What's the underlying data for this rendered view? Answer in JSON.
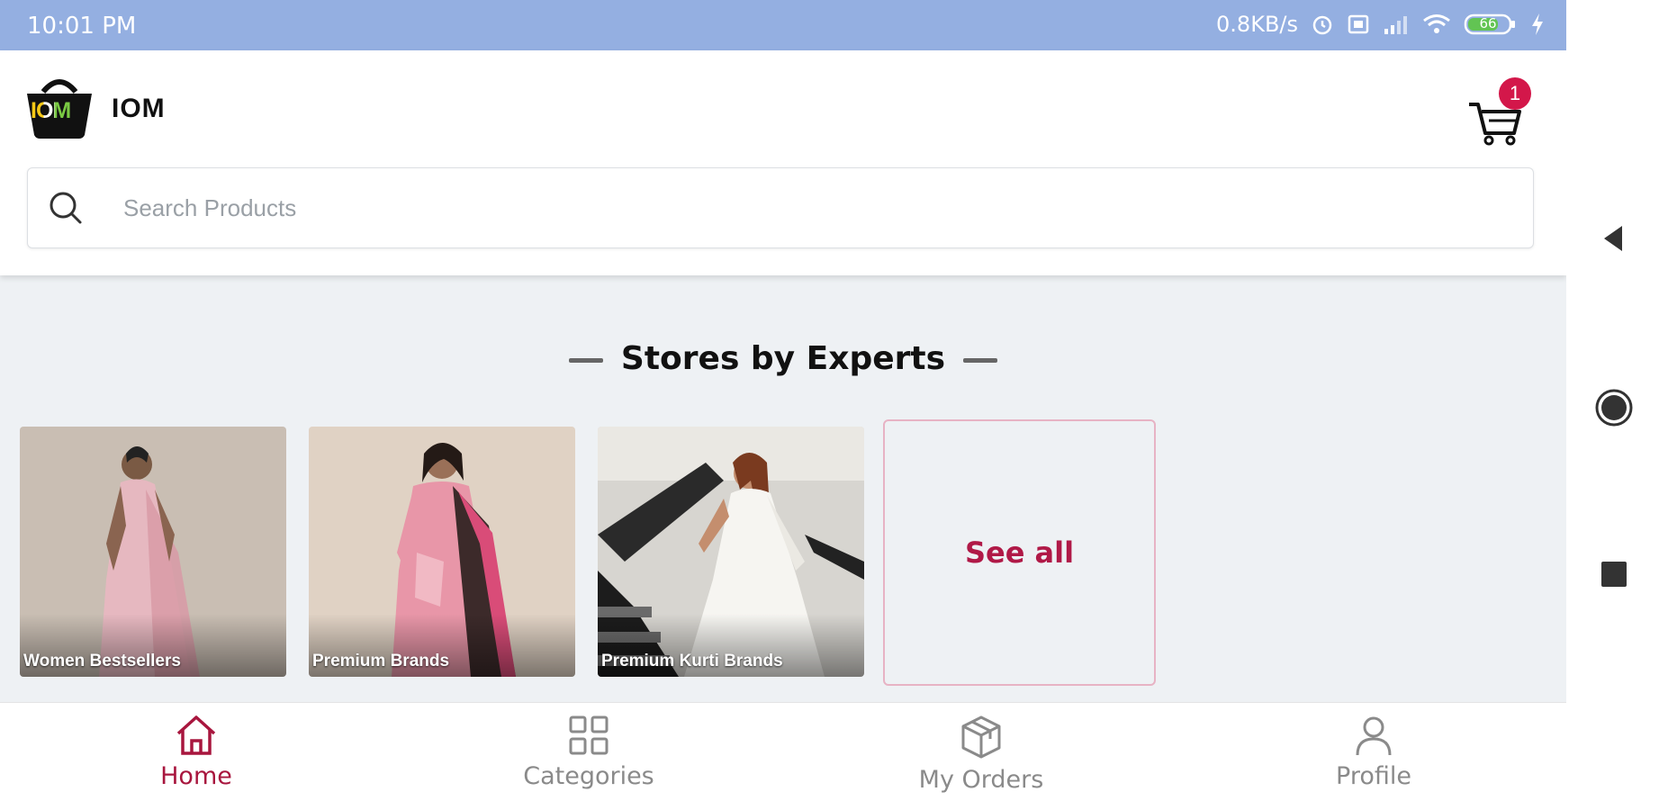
{
  "status_bar": {
    "time": "10:01 PM",
    "network_speed": "0.8KB/s",
    "battery_level": "66"
  },
  "app": {
    "title": "IOM",
    "logo_text": "IOM",
    "cart_count": "1"
  },
  "search": {
    "placeholder": "Search Products"
  },
  "section": {
    "title": "Stores by Experts"
  },
  "stores": [
    {
      "label": "Women Bestsellers"
    },
    {
      "label": "Premium Brands"
    },
    {
      "label": "Premium Kurti Brands"
    }
  ],
  "see_all_label": "See all",
  "bottom_nav": {
    "items": [
      {
        "label": "Home",
        "icon": "home-icon",
        "active": true
      },
      {
        "label": "Categories",
        "icon": "grid-icon",
        "active": false
      },
      {
        "label": "My Orders",
        "icon": "box-icon",
        "active": false
      },
      {
        "label": "Profile",
        "icon": "user-icon",
        "active": false
      }
    ]
  },
  "colors": {
    "status_bar": "#94afe1",
    "accent": "#a8163e",
    "badge": "#d3174a",
    "background": "#eef1f4"
  }
}
